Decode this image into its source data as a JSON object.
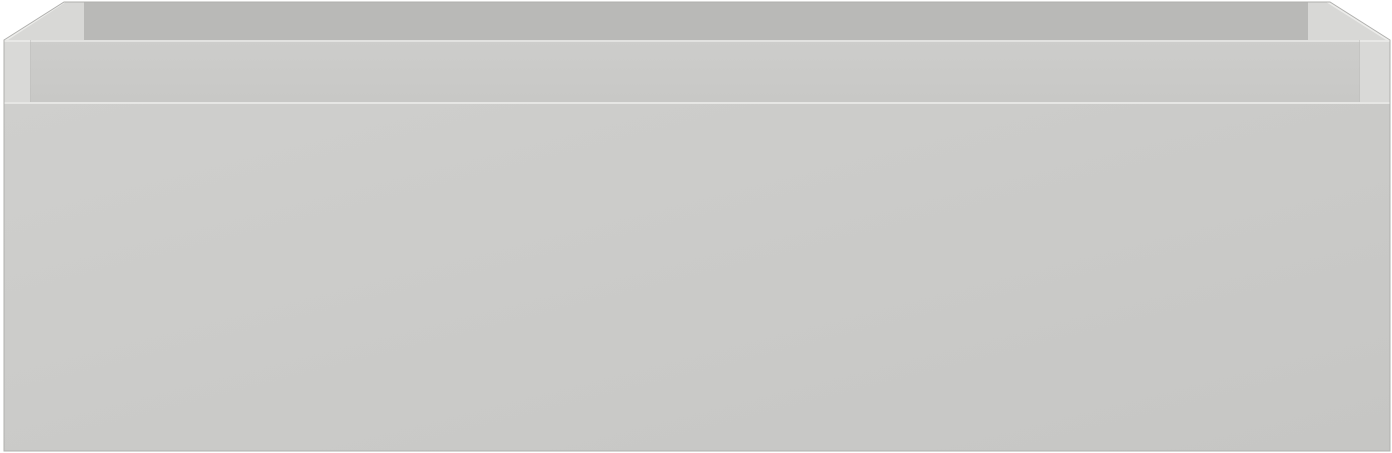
{
  "object": {
    "colors": {
      "background": "#ffffff",
      "front_light": "#cfcfcd",
      "front_dark": "#c6c6c4",
      "back_wall": "#b8b8b6",
      "back_wall_dark": "#a9a9a7",
      "rim": "#d6d6d4",
      "side_inner": "#dcdcda",
      "inner_panel": "#c9c9c7",
      "edge_highlight": "#ececea",
      "outline": "#b0b0ae"
    }
  }
}
